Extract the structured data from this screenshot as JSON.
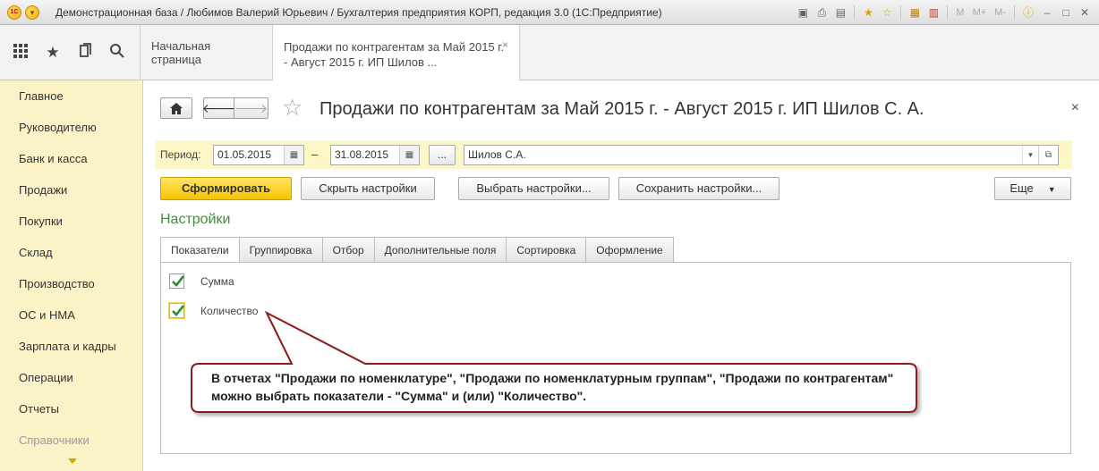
{
  "window": {
    "title": "Демонстрационная база / Любимов Валерий Юрьевич / Бухгалтерия предприятия КОРП, редакция 3.0  (1С:Предприятие)",
    "logo_text": "1С",
    "memory_buttons": [
      "M",
      "M+",
      "M-"
    ]
  },
  "tabs_strip": {
    "home_tab": "Начальная страница",
    "active_tab": "Продажи по контрагентам за Май 2015 г. - Август 2015 г. ИП Шилов ..."
  },
  "sidebar": {
    "items": [
      "Главное",
      "Руководителю",
      "Банк и касса",
      "Продажи",
      "Покупки",
      "Склад",
      "Производство",
      "ОС и НМА",
      "Зарплата и кадры",
      "Операции",
      "Отчеты",
      "Справочники"
    ]
  },
  "report": {
    "title": "Продажи по контрагентам за Май 2015 г. - Август 2015 г. ИП Шилов С. А.",
    "period_label": "Период:",
    "date_from": "01.05.2015",
    "date_separator": "–",
    "date_to": "31.08.2015",
    "dots_label": "...",
    "organization": "Шилов С.А."
  },
  "buttons": {
    "generate": "Сформировать",
    "hide_settings": "Скрыть настройки",
    "choose_settings": "Выбрать настройки...",
    "save_settings": "Сохранить настройки...",
    "more": "Еще"
  },
  "settings": {
    "heading": "Настройки",
    "tabs": [
      "Показатели",
      "Группировка",
      "Отбор",
      "Дополнительные поля",
      "Сортировка",
      "Оформление"
    ],
    "indicators": [
      {
        "label": "Сумма",
        "checked": true
      },
      {
        "label": "Количество",
        "checked": true
      }
    ]
  },
  "callout": {
    "text": "В отчетах \"Продажи по номенклатуре\", \"Продажи по номенклатурным группам\", \"Продажи по контрагентам\" можно выбрать показатели - \"Сумма\" и (или) \"Количество\".",
    "border_color": "#8b1a1a"
  },
  "colors": {
    "sidebar_bg": "#fbf3c8",
    "accent_yellow": "#f5c400",
    "settings_green": "#3d8f3a",
    "check_green": "#2e8b2e"
  }
}
